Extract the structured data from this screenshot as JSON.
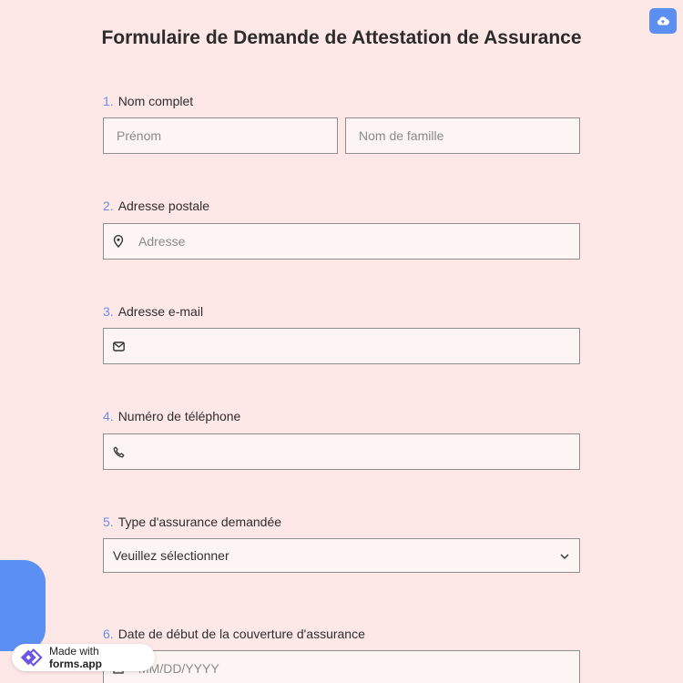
{
  "form": {
    "title": "Formulaire de Demande de Attestation de Assurance",
    "questions": [
      {
        "number": "1.",
        "label": "Nom complet",
        "fields": [
          {
            "placeholder": "Prénom"
          },
          {
            "placeholder": "Nom de famille"
          }
        ]
      },
      {
        "number": "2.",
        "label": "Adresse postale",
        "fields": [
          {
            "placeholder": "Adresse",
            "icon": "location-pin-icon"
          }
        ]
      },
      {
        "number": "3.",
        "label": "Adresse e-mail",
        "fields": [
          {
            "placeholder": "",
            "icon": "envelope-icon"
          }
        ]
      },
      {
        "number": "4.",
        "label": "Numéro de téléphone",
        "fields": [
          {
            "placeholder": "",
            "icon": "phone-icon"
          }
        ]
      },
      {
        "number": "5.",
        "label": "Type d'assurance demandée",
        "fields": [
          {
            "value": "Veuillez sélectionner",
            "icon": "chevron-down-icon"
          }
        ]
      },
      {
        "number": "6.",
        "label": "Date de début de la couverture d'assurance",
        "fields": [
          {
            "placeholder": "MM/DD/YYYY",
            "icon": "calendar-icon"
          }
        ]
      }
    ]
  },
  "toolbar": {
    "save_icon": "cloud-upload-icon"
  },
  "badge": {
    "prefix": "Made with ",
    "brand": "forms.app"
  },
  "colors": {
    "background": "#fde8e7",
    "accent": "#5b8ff2",
    "number": "#6a8ee6",
    "field_bg": "#fdf5f4",
    "border": "#8f8f8f"
  }
}
